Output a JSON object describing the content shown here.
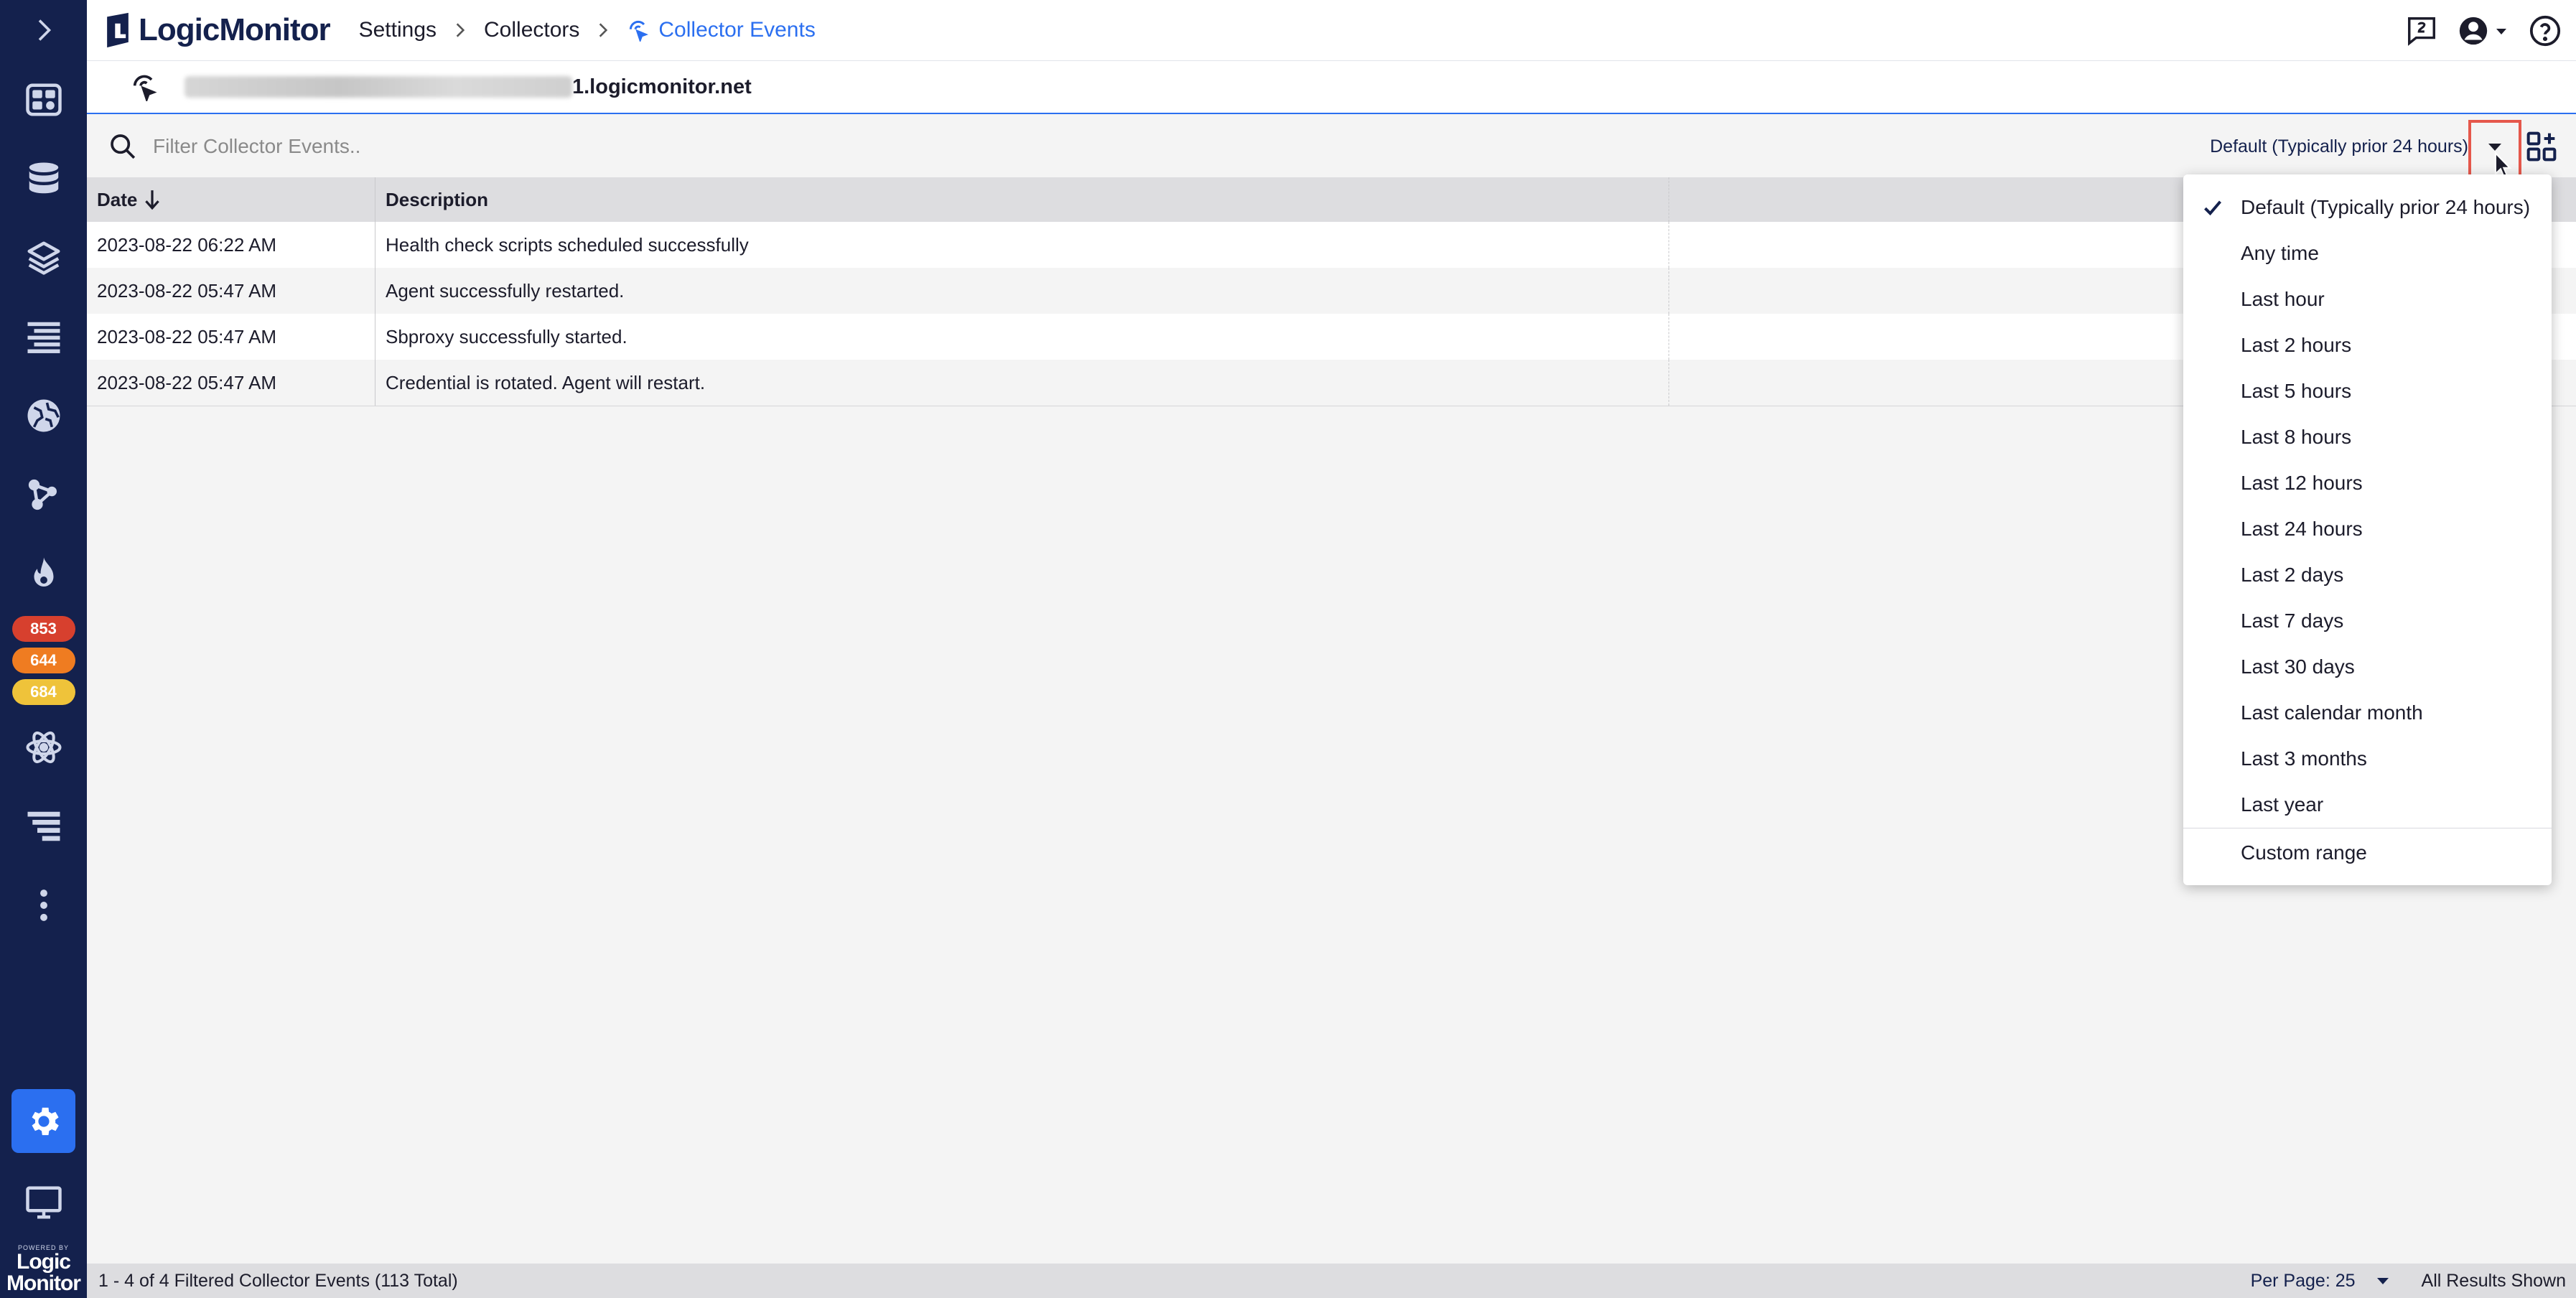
{
  "header": {
    "logo_text": "LogicMonitor",
    "breadcrumbs": [
      "Settings",
      "Collectors",
      "Collector Events"
    ]
  },
  "rail": {
    "badges": [
      {
        "value": "853",
        "color": "#d7402e"
      },
      {
        "value": "644",
        "color": "#ef7c21"
      },
      {
        "value": "684",
        "color": "#efc33a"
      }
    ],
    "powered_small": "POWERED BY",
    "powered_big_1": "Logic",
    "powered_big_2": "Monitor"
  },
  "collector": {
    "hostname_suffix": "1.logicmonitor.net"
  },
  "filter": {
    "placeholder": "Filter Collector Events..",
    "time_range_selected": "Default (Typically prior 24 hours)"
  },
  "table": {
    "columns": [
      "Date",
      "Description"
    ],
    "rows": [
      {
        "date": "2023-08-22 06:22 AM",
        "description": "Health check scripts scheduled successfully"
      },
      {
        "date": "2023-08-22 05:47 AM",
        "description": "Agent successfully restarted."
      },
      {
        "date": "2023-08-22 05:47 AM",
        "description": "Sbproxy successfully started."
      },
      {
        "date": "2023-08-22 05:47 AM",
        "description": "Credential is rotated. Agent will restart."
      }
    ]
  },
  "time_menu": {
    "items": [
      "Default (Typically prior 24 hours)",
      "Any time",
      "Last hour",
      "Last 2 hours",
      "Last 5 hours",
      "Last 8 hours",
      "Last 12 hours",
      "Last 24 hours",
      "Last 2 days",
      "Last 7 days",
      "Last 30 days",
      "Last calendar month",
      "Last 3 months",
      "Last year"
    ],
    "custom": "Custom range"
  },
  "status": {
    "count": "1 - 4 of 4 Filtered Collector Events (113 Total)",
    "per_page": "Per Page: 25",
    "all_results": "All Results Shown"
  },
  "colors": {
    "rail_bg": "#14214d",
    "accent": "#2b6ff0",
    "highlight_box": "#e5574b"
  }
}
